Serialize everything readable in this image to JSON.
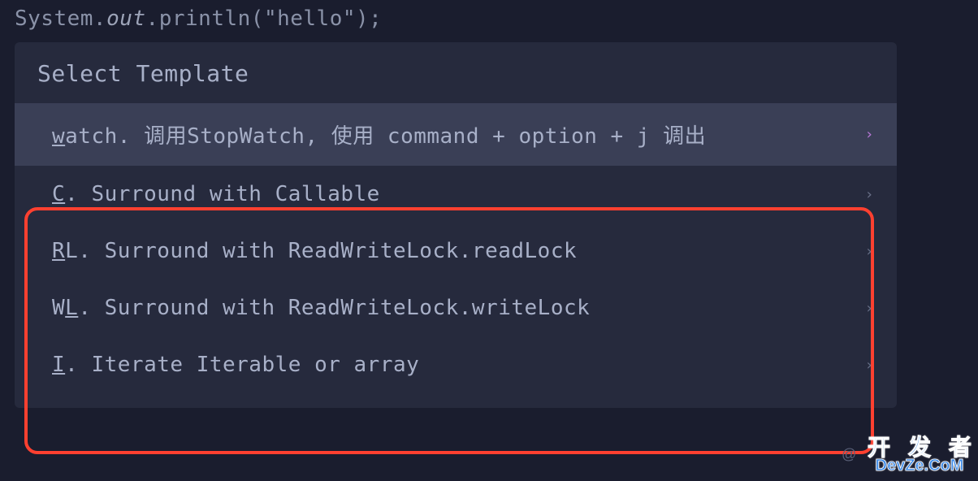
{
  "code": {
    "system": "System",
    "dot1": ".",
    "out": "out",
    "dot2": ".",
    "println": "println",
    "lparen": "(",
    "string": "\"hello\"",
    "rparen": ")",
    "semi": ";"
  },
  "popup": {
    "title": "Select Template",
    "items": [
      {
        "mnemonic": "w",
        "rest": "atch. 调用StopWatch, 使用 command + option + j 调出",
        "selected": true
      },
      {
        "mnemonic": "C",
        "rest": ". Surround with Callable",
        "selected": false
      },
      {
        "mnemonic": "R",
        "rest": "L. Surround with ReadWriteLock.readLock",
        "selected": false
      },
      {
        "mnemonic_prefix": "W",
        "mnemonic": "L",
        "rest": ". Surround with ReadWriteLock.writeLock",
        "selected": false
      },
      {
        "mnemonic": "I",
        "rest": ". Iterate Iterable or array",
        "selected": false
      }
    ]
  },
  "watermark": {
    "secondary": "@",
    "line1a": "开",
    "line1b": "发",
    "line1c": "者",
    "line2": "DevZe.CoM"
  }
}
